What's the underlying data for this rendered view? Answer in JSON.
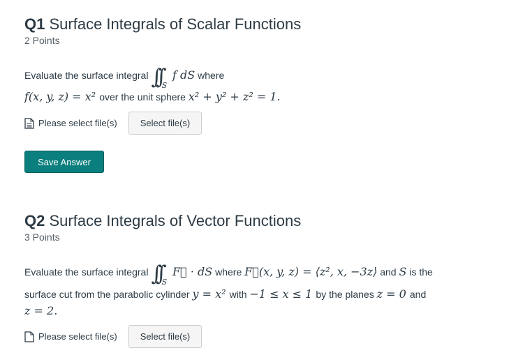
{
  "q1": {
    "number": "Q1",
    "title": "Surface Integrals of Scalar Functions",
    "points": "2 Points",
    "line1_prefix": "Evaluate the surface integral",
    "integral_sign": "∫∫",
    "integral_sub": "S",
    "integrand": "f dS",
    "line1_suffix": "where",
    "line2_math1": "f(x, y, z) = x² ",
    "line2_text": "over the unit sphere",
    "line2_math2": " x² + y² + z² = 1."
  },
  "q1_upload": {
    "label": "Please select file(s)",
    "button": "Select file(s)"
  },
  "save_button": "Save Answer",
  "q2": {
    "number": "Q2",
    "title": "Surface Integrals of Vector Functions",
    "points": "3 Points",
    "line1_prefix": "Evaluate the surface integral",
    "integral_sign": "∫∫",
    "integral_sub": "S",
    "integrand": "F⃗ · dS",
    "line1_mid": "where",
    "line1_math": "F⃗(x, y, z) = ⟨z², x, −3z⟩",
    "line1_and": "and",
    "line1_S": "S",
    "line1_end": "is the",
    "line2_text1": "surface cut from the parabolic cylinder",
    "line2_math1": " y = x² ",
    "line2_text2": "with",
    "line2_math2": " −1 ≤ x ≤ 1 ",
    "line2_text3": "by the planes",
    "line2_math3": " z = 0 ",
    "line2_text4": "and",
    "line3_math": "z = 2."
  },
  "q2_upload": {
    "label": "Please select file(s)",
    "button": "Select file(s)"
  }
}
